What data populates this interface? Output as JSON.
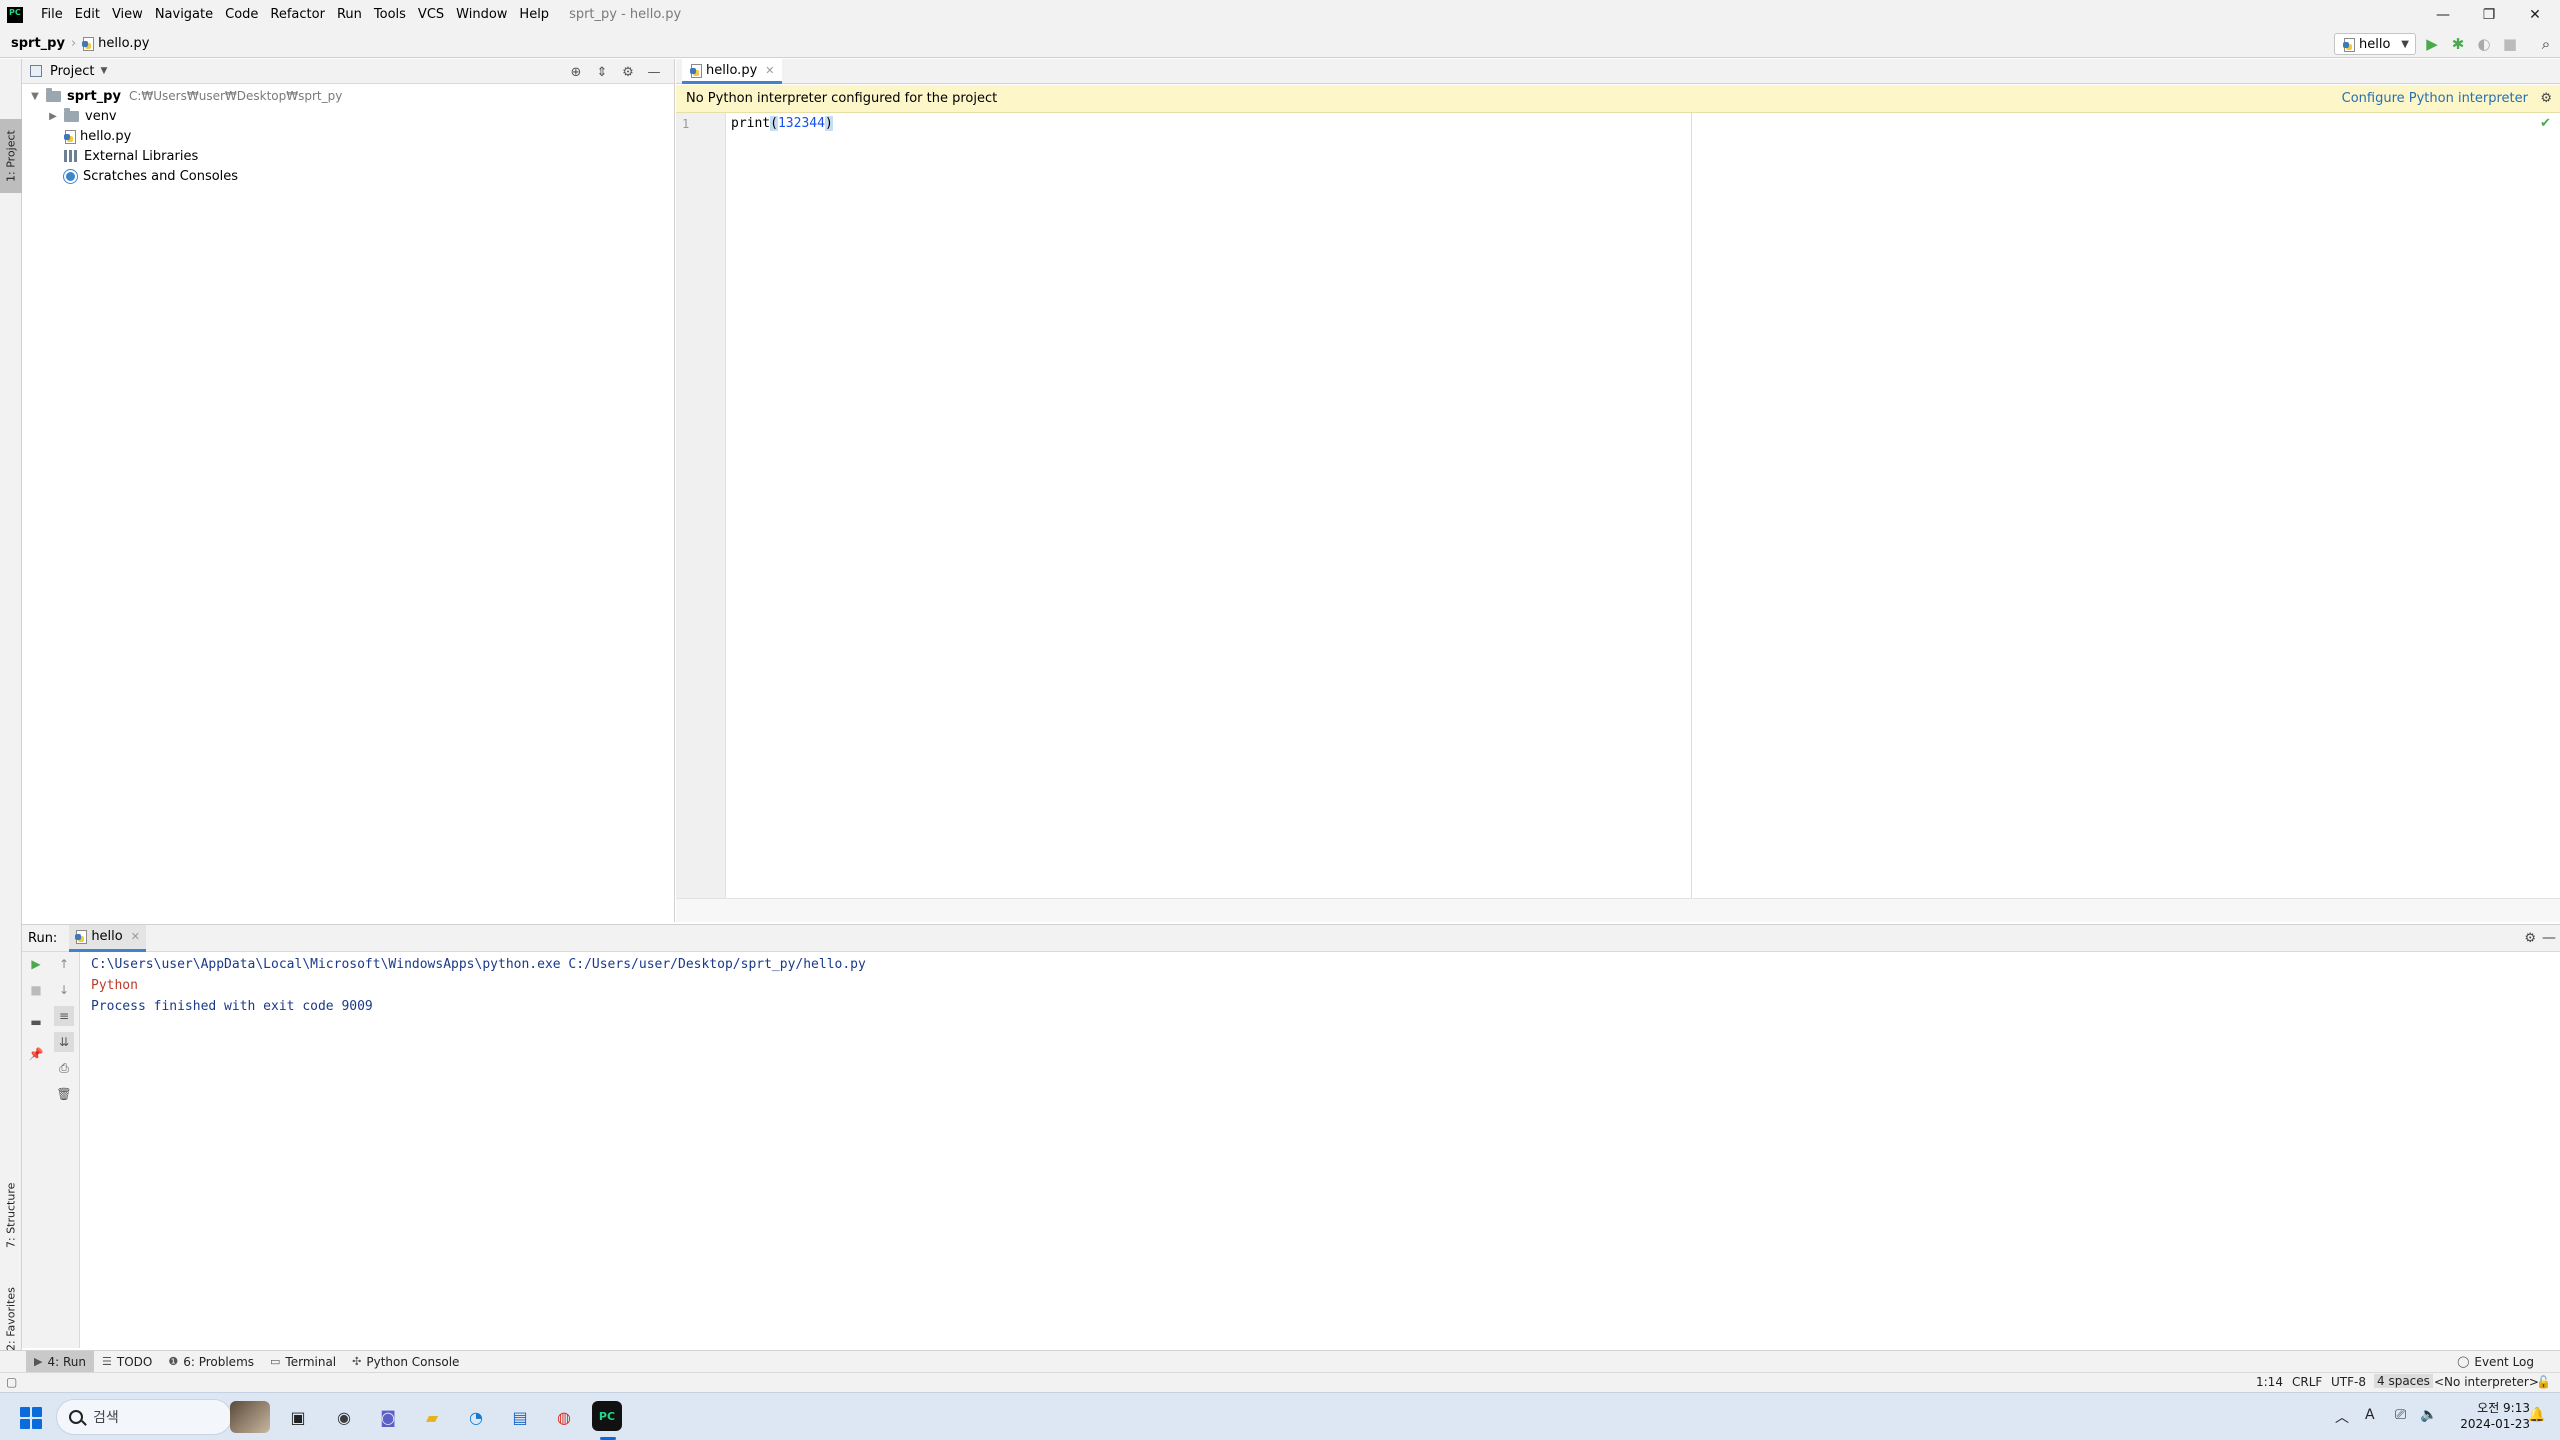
{
  "menubar": {
    "items": [
      "File",
      "Edit",
      "View",
      "Navigate",
      "Code",
      "Refactor",
      "Run",
      "Tools",
      "VCS",
      "Window",
      "Help"
    ],
    "window_title": "sprt_py - hello.py"
  },
  "window_controls": {
    "minimize": "—",
    "restore": "❐",
    "close": "✕"
  },
  "navbar": {
    "project": "sprt_py",
    "file": "hello.py",
    "run_config": "hello"
  },
  "left_stripe": {
    "project_tab": "1: Project",
    "structure_tab": "7: Structure",
    "favorites_tab": "2: Favorites"
  },
  "project_panel": {
    "title": "Project",
    "tree": [
      {
        "label": "sprt_py",
        "hint": "C:₩Users₩user₩Desktop₩sprt_py"
      },
      {
        "label": "venv"
      },
      {
        "label": "hello.py"
      },
      {
        "label": "External Libraries"
      },
      {
        "label": "Scratches and Consoles"
      }
    ]
  },
  "editor": {
    "tab_label": "hello.py",
    "banner_text": "No Python interpreter configured for the project",
    "banner_link": "Configure Python interpreter",
    "line_number": "1",
    "code_fn": "print",
    "code_open": "(",
    "code_num": "132344",
    "code_close": ")"
  },
  "run_panel": {
    "label": "Run:",
    "tab": "hello",
    "console": {
      "command": "C:\\Users\\user\\AppData\\Local\\Microsoft\\WindowsApps\\python.exe C:/Users/user/Desktop/sprt_py/hello.py",
      "output": "Python",
      "exit": "Process finished with exit code 9009"
    }
  },
  "bottom_tools": {
    "run": "4: Run",
    "todo": "TODO",
    "problems": "6: Problems",
    "terminal": "Terminal",
    "python_console": "Python Console",
    "event_log": "Event Log"
  },
  "statusbar": {
    "position": "1:14",
    "line_sep": "CRLF",
    "encoding": "UTF-8",
    "indent": "4 spaces",
    "interpreter": "<No interpreter>"
  },
  "taskbar": {
    "search_placeholder": "검색",
    "clock_time": "오전 9:13",
    "clock_date": "2024-01-23",
    "ime": "A"
  },
  "colors": {
    "accent": "#4083c9",
    "banner_bg": "#fdf6c8",
    "link": "#2470b3",
    "console_error": "#c0392b"
  }
}
